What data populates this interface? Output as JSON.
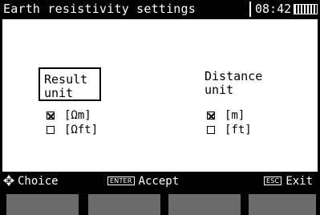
{
  "title_bar": {
    "title": "Earth resistivity settings",
    "clock": "08:42",
    "battery_icon": "battery-full-icon"
  },
  "result_unit": {
    "label": "Result\nunit",
    "options": [
      {
        "label": "[Ωm]",
        "checked": true
      },
      {
        "label": "[Ωft]",
        "checked": false
      }
    ]
  },
  "distance_unit": {
    "label": "Distance\nunit",
    "options": [
      {
        "label": "[m]",
        "checked": true
      },
      {
        "label": "[ft]",
        "checked": false
      }
    ]
  },
  "help_bar": {
    "choice_icon": "four-way-arrow-icon",
    "choice_label": "Choice",
    "enter_key": "ENTER",
    "accept_label": "Accept",
    "esc_key": "ESC",
    "exit_label": "Exit"
  },
  "colors": {
    "background": "#000000",
    "panel": "#ffffff",
    "softkey": "#6b6b6b"
  }
}
